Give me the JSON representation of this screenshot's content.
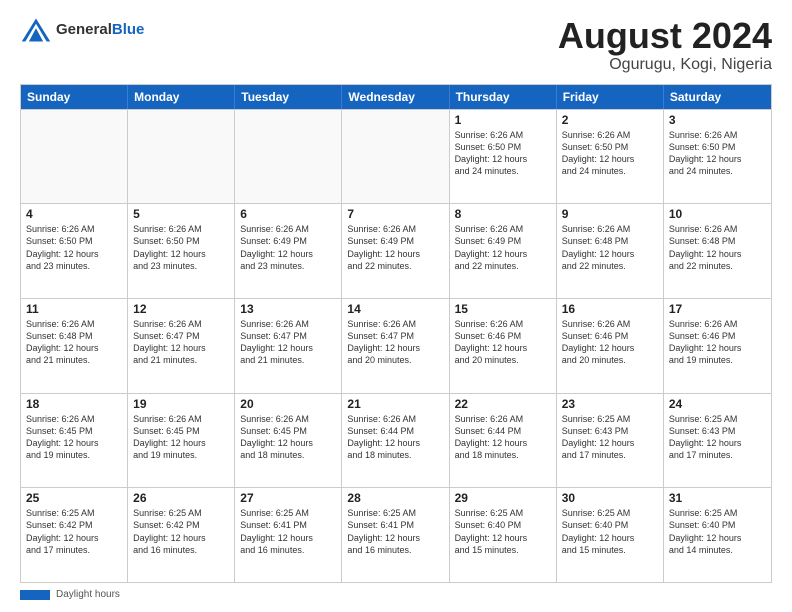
{
  "header": {
    "logo_general": "General",
    "logo_blue": "Blue",
    "title": "August 2024",
    "location": "Ogurugu, Kogi, Nigeria"
  },
  "calendar": {
    "days_of_week": [
      "Sunday",
      "Monday",
      "Tuesday",
      "Wednesday",
      "Thursday",
      "Friday",
      "Saturday"
    ],
    "weeks": [
      [
        {
          "day": "",
          "info": ""
        },
        {
          "day": "",
          "info": ""
        },
        {
          "day": "",
          "info": ""
        },
        {
          "day": "",
          "info": ""
        },
        {
          "day": "1",
          "info": "Sunrise: 6:26 AM\nSunset: 6:50 PM\nDaylight: 12 hours\nand 24 minutes."
        },
        {
          "day": "2",
          "info": "Sunrise: 6:26 AM\nSunset: 6:50 PM\nDaylight: 12 hours\nand 24 minutes."
        },
        {
          "day": "3",
          "info": "Sunrise: 6:26 AM\nSunset: 6:50 PM\nDaylight: 12 hours\nand 24 minutes."
        }
      ],
      [
        {
          "day": "4",
          "info": "Sunrise: 6:26 AM\nSunset: 6:50 PM\nDaylight: 12 hours\nand 23 minutes."
        },
        {
          "day": "5",
          "info": "Sunrise: 6:26 AM\nSunset: 6:50 PM\nDaylight: 12 hours\nand 23 minutes."
        },
        {
          "day": "6",
          "info": "Sunrise: 6:26 AM\nSunset: 6:49 PM\nDaylight: 12 hours\nand 23 minutes."
        },
        {
          "day": "7",
          "info": "Sunrise: 6:26 AM\nSunset: 6:49 PM\nDaylight: 12 hours\nand 22 minutes."
        },
        {
          "day": "8",
          "info": "Sunrise: 6:26 AM\nSunset: 6:49 PM\nDaylight: 12 hours\nand 22 minutes."
        },
        {
          "day": "9",
          "info": "Sunrise: 6:26 AM\nSunset: 6:48 PM\nDaylight: 12 hours\nand 22 minutes."
        },
        {
          "day": "10",
          "info": "Sunrise: 6:26 AM\nSunset: 6:48 PM\nDaylight: 12 hours\nand 22 minutes."
        }
      ],
      [
        {
          "day": "11",
          "info": "Sunrise: 6:26 AM\nSunset: 6:48 PM\nDaylight: 12 hours\nand 21 minutes."
        },
        {
          "day": "12",
          "info": "Sunrise: 6:26 AM\nSunset: 6:47 PM\nDaylight: 12 hours\nand 21 minutes."
        },
        {
          "day": "13",
          "info": "Sunrise: 6:26 AM\nSunset: 6:47 PM\nDaylight: 12 hours\nand 21 minutes."
        },
        {
          "day": "14",
          "info": "Sunrise: 6:26 AM\nSunset: 6:47 PM\nDaylight: 12 hours\nand 20 minutes."
        },
        {
          "day": "15",
          "info": "Sunrise: 6:26 AM\nSunset: 6:46 PM\nDaylight: 12 hours\nand 20 minutes."
        },
        {
          "day": "16",
          "info": "Sunrise: 6:26 AM\nSunset: 6:46 PM\nDaylight: 12 hours\nand 20 minutes."
        },
        {
          "day": "17",
          "info": "Sunrise: 6:26 AM\nSunset: 6:46 PM\nDaylight: 12 hours\nand 19 minutes."
        }
      ],
      [
        {
          "day": "18",
          "info": "Sunrise: 6:26 AM\nSunset: 6:45 PM\nDaylight: 12 hours\nand 19 minutes."
        },
        {
          "day": "19",
          "info": "Sunrise: 6:26 AM\nSunset: 6:45 PM\nDaylight: 12 hours\nand 19 minutes."
        },
        {
          "day": "20",
          "info": "Sunrise: 6:26 AM\nSunset: 6:45 PM\nDaylight: 12 hours\nand 18 minutes."
        },
        {
          "day": "21",
          "info": "Sunrise: 6:26 AM\nSunset: 6:44 PM\nDaylight: 12 hours\nand 18 minutes."
        },
        {
          "day": "22",
          "info": "Sunrise: 6:26 AM\nSunset: 6:44 PM\nDaylight: 12 hours\nand 18 minutes."
        },
        {
          "day": "23",
          "info": "Sunrise: 6:25 AM\nSunset: 6:43 PM\nDaylight: 12 hours\nand 17 minutes."
        },
        {
          "day": "24",
          "info": "Sunrise: 6:25 AM\nSunset: 6:43 PM\nDaylight: 12 hours\nand 17 minutes."
        }
      ],
      [
        {
          "day": "25",
          "info": "Sunrise: 6:25 AM\nSunset: 6:42 PM\nDaylight: 12 hours\nand 17 minutes."
        },
        {
          "day": "26",
          "info": "Sunrise: 6:25 AM\nSunset: 6:42 PM\nDaylight: 12 hours\nand 16 minutes."
        },
        {
          "day": "27",
          "info": "Sunrise: 6:25 AM\nSunset: 6:41 PM\nDaylight: 12 hours\nand 16 minutes."
        },
        {
          "day": "28",
          "info": "Sunrise: 6:25 AM\nSunset: 6:41 PM\nDaylight: 12 hours\nand 16 minutes."
        },
        {
          "day": "29",
          "info": "Sunrise: 6:25 AM\nSunset: 6:40 PM\nDaylight: 12 hours\nand 15 minutes."
        },
        {
          "day": "30",
          "info": "Sunrise: 6:25 AM\nSunset: 6:40 PM\nDaylight: 12 hours\nand 15 minutes."
        },
        {
          "day": "31",
          "info": "Sunrise: 6:25 AM\nSunset: 6:40 PM\nDaylight: 12 hours\nand 14 minutes."
        }
      ]
    ]
  },
  "footer": {
    "label": "Daylight hours"
  }
}
